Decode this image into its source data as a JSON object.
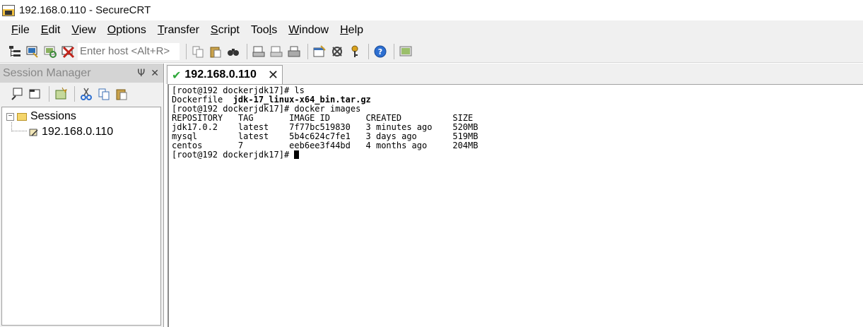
{
  "window": {
    "title": "192.168.0.110 - SecureCRT"
  },
  "menu": [
    {
      "label": "File",
      "u": "F",
      "rest": "ile"
    },
    {
      "label": "Edit",
      "u": "E",
      "rest": "dit"
    },
    {
      "label": "View",
      "u": "V",
      "rest": "iew"
    },
    {
      "label": "Options",
      "u": "O",
      "rest": "ptions"
    },
    {
      "label": "Transfer",
      "u": "T",
      "rest": "ransfer"
    },
    {
      "label": "Script",
      "u": "S",
      "rest": "cript"
    },
    {
      "label": "Tools",
      "pre": "Too",
      "u": "l",
      "rest": "s"
    },
    {
      "label": "Window",
      "u": "W",
      "rest": "indow"
    },
    {
      "label": "Help",
      "u": "H",
      "rest": "elp"
    }
  ],
  "toolbar": {
    "host_placeholder": "Enter host <Alt+R>"
  },
  "session_manager": {
    "title": "Session Manager",
    "pin_glyph": "Ψ",
    "close_glyph": "✕",
    "tree": {
      "root": "Sessions",
      "session": "192.168.0.110"
    }
  },
  "tab": {
    "label": "192.168.0.110",
    "close_glyph": "✕"
  },
  "terminal": {
    "prompt": "[root@192 dockerjdk17]#",
    "cmd1": " ls",
    "ls_file1": "Dockerfile  ",
    "ls_file2": "jdk-17_linux-x64_bin.tar.gz",
    "cmd2": " docker images",
    "table_header": "REPOSITORY   TAG       IMAGE ID       CREATED          SIZE",
    "rows": [
      "jdk17.0.2    latest    7f77bc519830   3 minutes ago    520MB",
      "mysql        latest    5b4c624c7fe1   3 days ago       519MB",
      "centos       7         eeb6ee3f44bd   4 months ago     204MB"
    ]
  },
  "colors": {
    "accent_green": "#2ea83a",
    "chrome": "#f0f0f0"
  }
}
